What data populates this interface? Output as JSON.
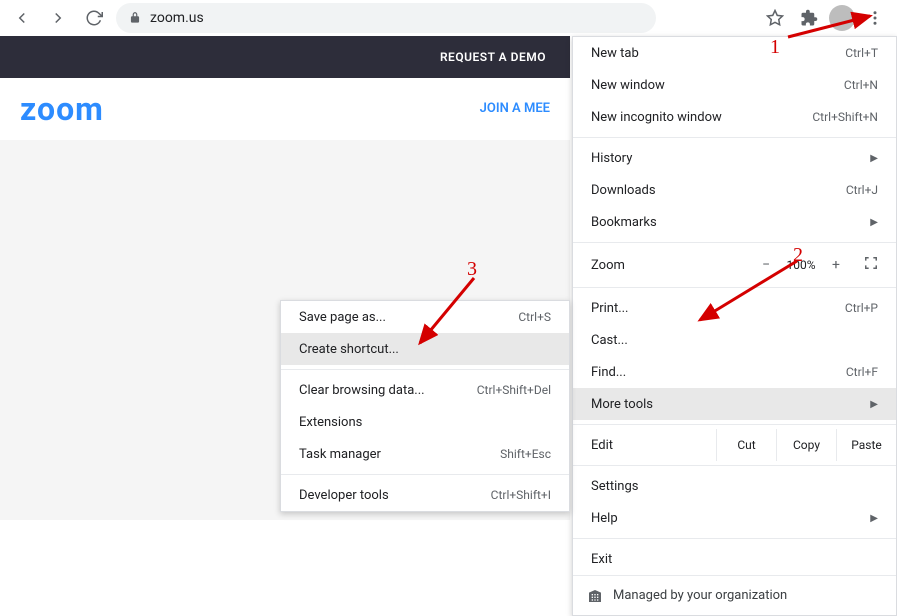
{
  "browser": {
    "url": "zoom.us"
  },
  "page": {
    "demo": "REQUEST A DEMO",
    "logo": "zoom",
    "join": "JOIN A MEE"
  },
  "menu": {
    "new_tab": "New tab",
    "new_tab_sc": "Ctrl+T",
    "new_window": "New window",
    "new_window_sc": "Ctrl+N",
    "new_incognito": "New incognito window",
    "new_incognito_sc": "Ctrl+Shift+N",
    "history": "History",
    "downloads": "Downloads",
    "downloads_sc": "Ctrl+J",
    "bookmarks": "Bookmarks",
    "zoom_label": "Zoom",
    "zoom_pct": "100%",
    "print": "Print...",
    "print_sc": "Ctrl+P",
    "cast": "Cast...",
    "find": "Find...",
    "find_sc": "Ctrl+F",
    "more_tools": "More tools",
    "edit": "Edit",
    "cut": "Cut",
    "copy": "Copy",
    "paste": "Paste",
    "settings": "Settings",
    "help": "Help",
    "exit": "Exit",
    "managed": "Managed by your organization"
  },
  "submenu": {
    "save_page": "Save page as...",
    "save_page_sc": "Ctrl+S",
    "create_shortcut": "Create shortcut...",
    "clear_data": "Clear browsing data...",
    "clear_data_sc": "Ctrl+Shift+Del",
    "extensions": "Extensions",
    "task_manager": "Task manager",
    "task_manager_sc": "Shift+Esc",
    "dev_tools": "Developer tools",
    "dev_tools_sc": "Ctrl+Shift+I"
  },
  "annotations": {
    "n1": "1",
    "n2": "2",
    "n3": "3"
  }
}
